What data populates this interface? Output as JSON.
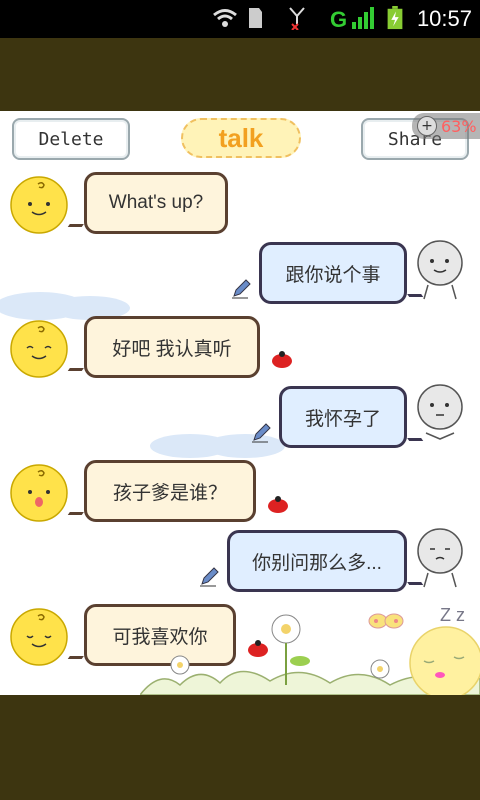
{
  "status_bar": {
    "time": "10:57",
    "icons": [
      "wifi-icon",
      "sd-card-icon",
      "no-signal-icon",
      "g-signal-icon",
      "battery-charging-icon"
    ]
  },
  "toolbar": {
    "delete_label": "Delete",
    "talk_label": "talk",
    "share_label": "Share",
    "zoom_label": "63%"
  },
  "messages": [
    {
      "side": "left",
      "text": "What's up?",
      "avatar": "chick-avatar",
      "status": "none"
    },
    {
      "side": "right",
      "text": "跟你说个事",
      "avatar": "doodle-avatar",
      "status": "pencil"
    },
    {
      "side": "left",
      "text": "好吧 我认真听",
      "avatar": "chick-avatar",
      "status": "bug"
    },
    {
      "side": "right",
      "text": "我怀孕了",
      "avatar": "doodle-avatar",
      "status": "pencil"
    },
    {
      "side": "left",
      "text": "孩子爹是谁？",
      "avatar": "chick-avatar",
      "status": "bug"
    },
    {
      "side": "right",
      "text": "你别问那么多...",
      "avatar": "doodle-avatar",
      "status": "pencil"
    },
    {
      "side": "left",
      "text": "可我喜欢你",
      "avatar": "chick-avatar",
      "status": "bug"
    }
  ],
  "decor": {
    "sleep_text": "Z z"
  }
}
